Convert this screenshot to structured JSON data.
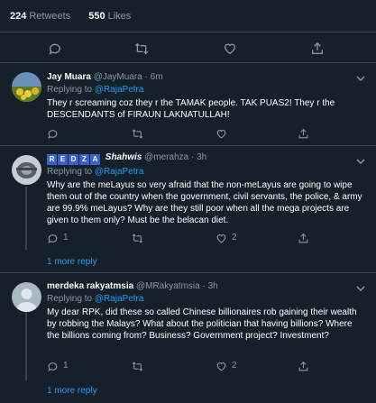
{
  "stats": {
    "retweets_count": "224",
    "retweets_label": "Retweets",
    "likes_count": "550",
    "likes_label": "Likes"
  },
  "colors": {
    "background": "#15202b",
    "border": "#38444d",
    "muted": "#8899a6",
    "accent": "#1da1f2"
  },
  "icons": {
    "reply": "reply-icon",
    "retweet": "retweet-icon",
    "like": "heart-icon",
    "share": "share-icon",
    "more": "chevron-down-icon"
  },
  "replies": [
    {
      "name": "Jay Muara",
      "handle": "@JayMuara",
      "time": "· 6m",
      "replying_label": "Replying to",
      "replying_to": "@RajaPetra",
      "text": "They r screaming coz they r the TAMAK people. TAK PUAS2! They r the DESCENDANTS of FIRAUN LAKNATULLAH!"
    },
    {
      "name_badge": [
        "R",
        "E",
        "D",
        "Z",
        "A"
      ],
      "name": "Shahwis",
      "handle": "@merahza",
      "time": "· 3h",
      "replying_label": "Replying to",
      "replying_to": "@RajaPetra",
      "text": "Why are the meLayus so very afraid that the non-meLayus are going to wipe them out of the country when the government, civil servants, the police, & army are 99.9% meLayus? Why are they still poor when all the mega projects are given to them only? Must be the belacan diet.",
      "reply_count": "1",
      "like_count": "2",
      "more_reply": "1 more reply"
    },
    {
      "name": "merdeka rakyatmsia",
      "handle": "@MRakyatmsia",
      "time": "· 3h",
      "replying_label": "Replying to",
      "replying_to": "@RajaPetra",
      "text": "My dear RPK, did these so called Chinese billionaires rob gaining their wealth by robbing the Malays? What about the politician that having billions? Where the billions coming from? Business? Government project? Investment?",
      "reply_count": "1",
      "like_count": "2",
      "more_reply": "1 more reply"
    }
  ]
}
